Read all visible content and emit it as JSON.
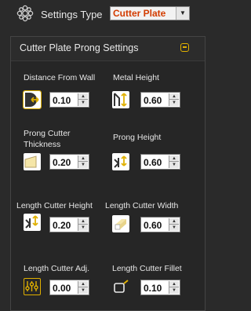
{
  "header": {
    "label": "Settings Type",
    "type_selected": "Cutter Plate",
    "icon": "settings-gear-icon"
  },
  "panel": {
    "title": "Cutter Plate Prong Settings",
    "collapse_icon": "collapse-minus-icon"
  },
  "fields": {
    "distance_from_wall": {
      "label": "Distance From Wall",
      "value": "0.10",
      "icon": "distance-wall-icon"
    },
    "metal_height": {
      "label": "Metal Height",
      "value": "0.60",
      "icon": "metal-height-icon"
    },
    "prong_cutter_thickness": {
      "label": "Prong  Cutter\nThickness",
      "value": "0.20",
      "icon": "prong-cutter-thickness-icon"
    },
    "prong_height": {
      "label": "Prong Height",
      "value": "0.60",
      "icon": "prong-height-icon"
    },
    "length_cutter_height": {
      "label": "Length Cutter Height",
      "value": "0.20",
      "icon": "length-cutter-height-icon"
    },
    "length_cutter_width": {
      "label": "Length Cutter Width",
      "value": "0.60",
      "icon": "length-cutter-width-icon"
    },
    "length_cutter_adj": {
      "label": "Length Cutter Adj.",
      "value": "0.00",
      "icon": "adjust-sliders-icon"
    },
    "length_cutter_fillet": {
      "label": "Length Cutter Fillet",
      "value": "0.10",
      "icon": "fillet-icon"
    }
  },
  "colors": {
    "accent": "#e0b000",
    "select_text": "#d33c00"
  }
}
